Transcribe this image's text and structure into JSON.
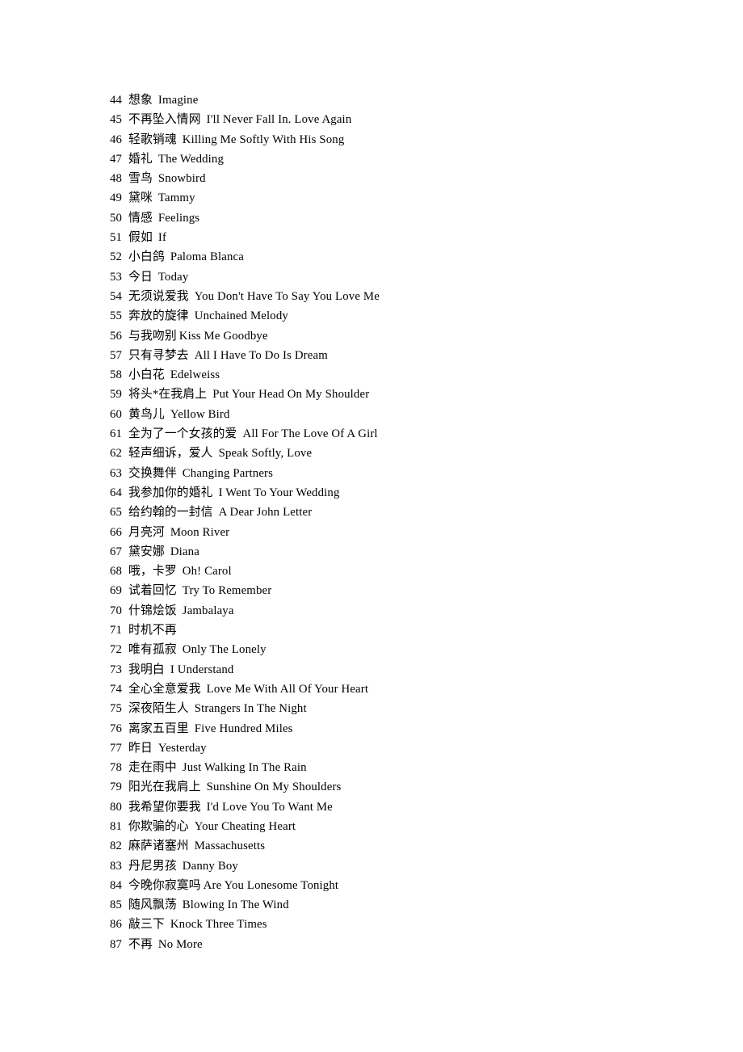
{
  "document": {
    "type": "song-list",
    "background_color": "#ffffff",
    "text_color": "#000000",
    "first_item_number": 44,
    "last_item_number": 87,
    "total_items": 44
  },
  "songs": [
    {
      "num": "44",
      "cn": "想象",
      "en": "Imagine",
      "gap": "wide"
    },
    {
      "num": "45",
      "cn": "不再坠入情网",
      "en": "I'll Never Fall In. Love Again",
      "gap": "wide"
    },
    {
      "num": "46",
      "cn": "轻歌销魂",
      "en": "Killing Me Softly With His Song",
      "gap": "wide"
    },
    {
      "num": "47",
      "cn": "婚礼",
      "en": "The Wedding",
      "gap": "wide"
    },
    {
      "num": "48",
      "cn": "雪鸟",
      "en": "Snowbird",
      "gap": "wide"
    },
    {
      "num": "49",
      "cn": "黛咪",
      "en": "Tammy",
      "gap": "wide"
    },
    {
      "num": "50",
      "cn": "情感",
      "en": "Feelings",
      "gap": "wide"
    },
    {
      "num": "51",
      "cn": "假如",
      "en": "If",
      "gap": "wide"
    },
    {
      "num": "52",
      "cn": "小白鸽",
      "en": "Paloma Blanca",
      "gap": "wide"
    },
    {
      "num": "53",
      "cn": "今日",
      "en": "Today",
      "gap": "wide"
    },
    {
      "num": "54",
      "cn": "无须说爱我",
      "en": "You Don't Have To Say You Love Me",
      "gap": "wide"
    },
    {
      "num": "55",
      "cn": "奔放的旋律",
      "en": "Unchained Melody",
      "gap": "wide"
    },
    {
      "num": "56",
      "cn": "与我吻别",
      "en": "Kiss Me Goodbye",
      "gap": "narrow"
    },
    {
      "num": "57",
      "cn": "只有寻梦去",
      "en": "All I Have To Do Is Dream",
      "gap": "wide"
    },
    {
      "num": "58",
      "cn": "小白花",
      "en": "Edelweiss",
      "gap": "wide"
    },
    {
      "num": "59",
      "cn": "将头*在我肩上",
      "en": "Put Your Head On My Shoulder",
      "gap": "wide"
    },
    {
      "num": "60",
      "cn": "黄鸟儿",
      "en": "Yellow Bird",
      "gap": "wide"
    },
    {
      "num": "61",
      "cn": "全为了一个女孩的爱",
      "en": "All For The Love Of A Girl",
      "gap": "wide"
    },
    {
      "num": "62",
      "cn": "轻声细诉，爱人",
      "en": "Speak Softly, Love",
      "gap": "wide"
    },
    {
      "num": "63",
      "cn": "交换舞伴",
      "en": "Changing Partners",
      "gap": "wide"
    },
    {
      "num": "64",
      "cn": "我参加你的婚礼",
      "en": "I Went To Your Wedding",
      "gap": "wide"
    },
    {
      "num": "65",
      "cn": "给约翰的一封信",
      "en": "A Dear John Letter",
      "gap": "wide"
    },
    {
      "num": "66",
      "cn": "月亮河",
      "en": "Moon River",
      "gap": "wide"
    },
    {
      "num": "67",
      "cn": "黛安娜",
      "en": "Diana",
      "gap": "wide"
    },
    {
      "num": "68",
      "cn": "哦，卡罗",
      "en": "Oh! Carol",
      "gap": "wide"
    },
    {
      "num": "69",
      "cn": "试着回忆",
      "en": "Try To Remember",
      "gap": "wide"
    },
    {
      "num": "70",
      "cn": "什锦烩饭",
      "en": "Jambalaya",
      "gap": "wide"
    },
    {
      "num": "71",
      "cn": "时机不再",
      "en": "",
      "gap": "wide"
    },
    {
      "num": "72",
      "cn": "唯有孤寂",
      "en": "Only The Lonely",
      "gap": "wide"
    },
    {
      "num": "73",
      "cn": "我明白",
      "en": "I Understand",
      "gap": "wide"
    },
    {
      "num": "74",
      "cn": "全心全意爱我",
      "en": "Love Me With All Of Your Heart",
      "gap": "wide"
    },
    {
      "num": "75",
      "cn": "深夜陌生人",
      "en": "Strangers In The Night",
      "gap": "wide"
    },
    {
      "num": "76",
      "cn": "离家五百里",
      "en": "Five Hundred Miles",
      "gap": "wide"
    },
    {
      "num": "77",
      "cn": "昨日",
      "en": "Yesterday",
      "gap": "wide"
    },
    {
      "num": "78",
      "cn": "走在雨中",
      "en": "Just Walking In The Rain",
      "gap": "wide"
    },
    {
      "num": "79",
      "cn": "阳光在我肩上",
      "en": "Sunshine On My Shoulders",
      "gap": "wide"
    },
    {
      "num": "80",
      "cn": "我希望你要我",
      "en": "I'd Love You To Want Me",
      "gap": "wide"
    },
    {
      "num": "81",
      "cn": "你欺骗的心",
      "en": "Your Cheating Heart",
      "gap": "wide"
    },
    {
      "num": "82",
      "cn": "麻萨诸塞州",
      "en": "Massachusetts",
      "gap": "wide"
    },
    {
      "num": "83",
      "cn": "丹尼男孩",
      "en": "Danny Boy",
      "gap": "wide"
    },
    {
      "num": "84",
      "cn": "今晚你寂寞吗",
      "en": "Are You Lonesome Tonight",
      "gap": "narrow"
    },
    {
      "num": "85",
      "cn": "随风飘荡",
      "en": "Blowing In The Wind",
      "gap": "wide"
    },
    {
      "num": "86",
      "cn": "敲三下",
      "en": "Knock Three Times",
      "gap": "wide"
    },
    {
      "num": "87",
      "cn": "不再",
      "en": "No More",
      "gap": "wide"
    }
  ]
}
